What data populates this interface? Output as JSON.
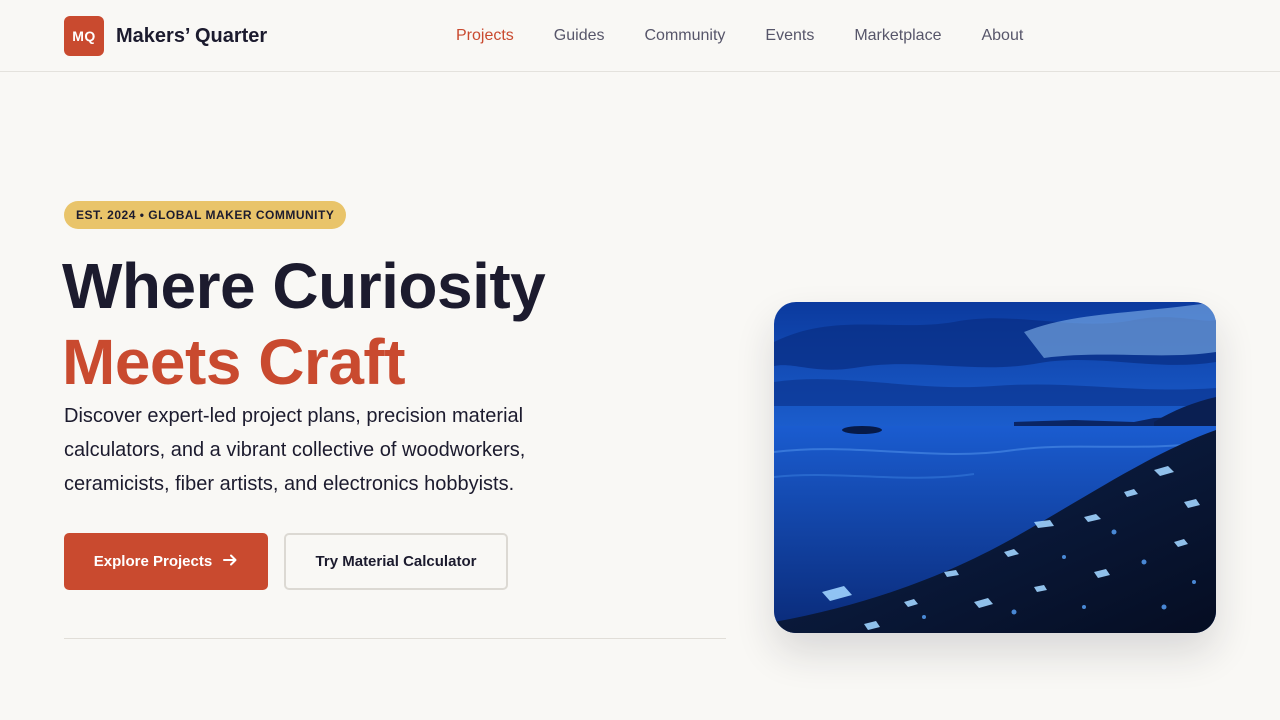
{
  "brand": {
    "logo_text": "MQ",
    "name": "Makers’ Quarter"
  },
  "nav": [
    {
      "label": "Projects",
      "active": true
    },
    {
      "label": "Guides",
      "active": false
    },
    {
      "label": "Community",
      "active": false
    },
    {
      "label": "Events",
      "active": false
    },
    {
      "label": "Marketplace",
      "active": false
    },
    {
      "label": "About",
      "active": false
    }
  ],
  "hero": {
    "badge": "EST. 2024 • GLOBAL MAKER COMMUNITY",
    "headline_line1": "Where Curiosity",
    "headline_line2": "Meets Craft",
    "description": "Discover expert-led project plans, precision material calculators, and a vibrant collective of woodworkers, ceramicists, fiber artists, and electronics hobbyists.",
    "primary_cta": "Explore Projects",
    "secondary_cta": "Try Material Calculator",
    "image_icon": "photo-blue-lake-shore"
  },
  "colors": {
    "accent": "#c94a2f",
    "badge": "#e9c46a",
    "text": "#1c1b2e",
    "background": "#f9f8f5"
  }
}
